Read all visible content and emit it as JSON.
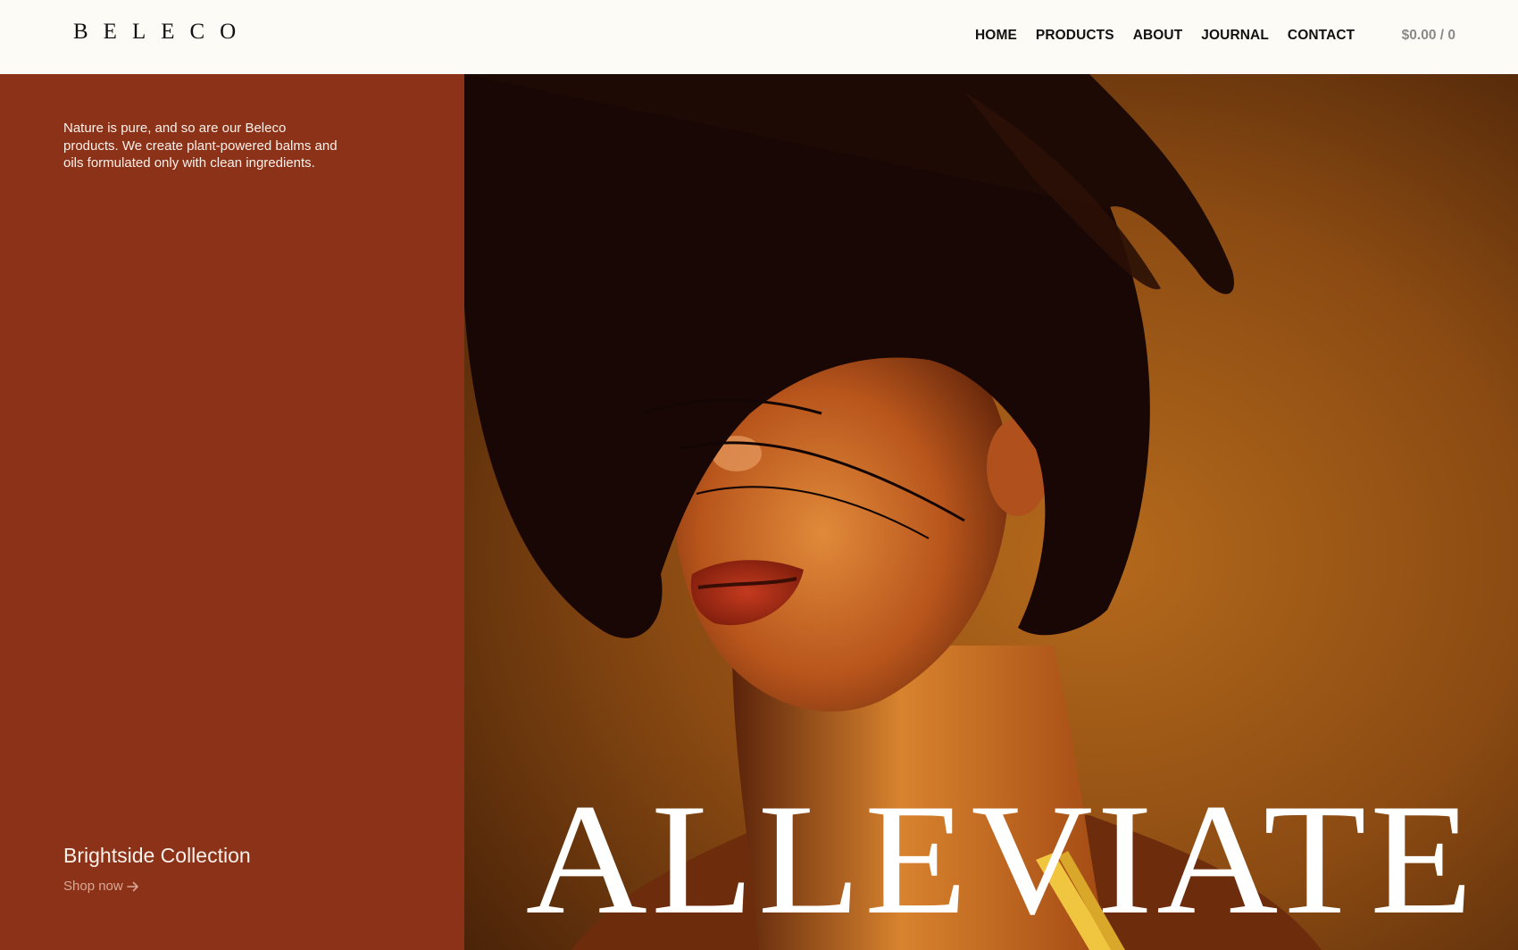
{
  "header": {
    "logo": "BELECO",
    "nav": [
      "HOME",
      "PRODUCTS",
      "ABOUT",
      "JOURNAL",
      "CONTACT"
    ],
    "cart": "$0.00 / 0"
  },
  "left_panel": {
    "intro": "Nature is pure, and so are our Beleco products. We create plant-powered balms and oils formulated only with clean ingredients.",
    "collection_title": "Brightside Collection",
    "shop_link": "Shop now",
    "shop_icon": "arrow-right-icon"
  },
  "hero": {
    "headline": "ALLEVIATE",
    "image_subject": "portrait of woman with dark bob hair covering eyes in warm amber light"
  },
  "colors": {
    "header_bg": "#fcfbf6",
    "panel_bg": "#8b3218",
    "hero_bg": "#7a3d12",
    "text_light": "#fbf1ea",
    "link_muted": "#d9a896",
    "cart_grey": "#8a8a86"
  }
}
